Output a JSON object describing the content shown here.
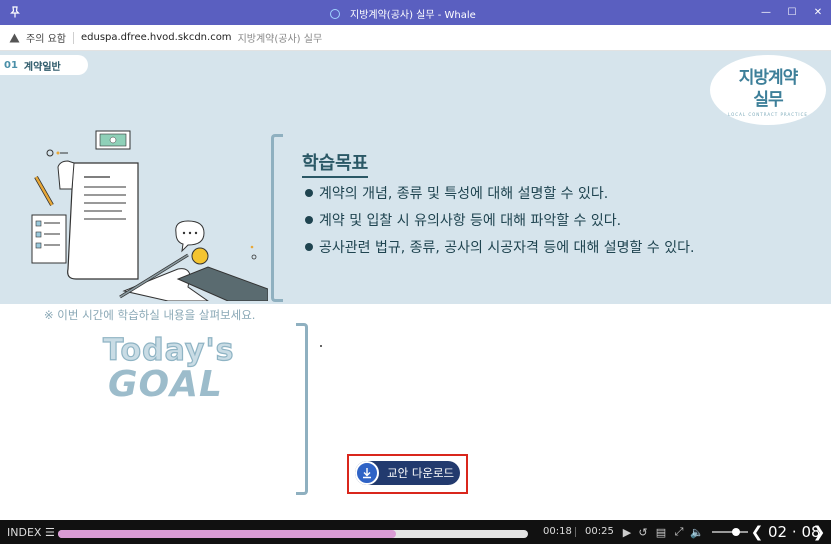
{
  "window": {
    "title": "지방계약(공사) 실무 - Whale"
  },
  "address": {
    "warning": "주의 요함",
    "url": "eduspa.dfree.hvod.skcdn.com",
    "page_title": "지방계약(공사) 실무"
  },
  "chapter": {
    "number": "01",
    "name": "계약일반"
  },
  "logo": {
    "line1": "지방계약",
    "line2": "실무",
    "tagline": "LOCAL CONTRACT PRACTICE"
  },
  "goals": {
    "title": "학습목표",
    "items": [
      "계약의 개념, 종류 및 특성에 대해 설명할 수 있다.",
      "계약 및 입찰 시 유의사항 등에 대해 파악할 수 있다.",
      "공사관련 법규, 종류, 공사의 시공자격 등에 대해 설명할 수 있다."
    ]
  },
  "hint": "※ 이번 시간에 학습하실 내용을 살펴보세요.",
  "today": {
    "line1": "Today's",
    "line2": "GOAL"
  },
  "download": {
    "label": "교안 다운로드"
  },
  "player": {
    "index_label": "INDEX",
    "current_time": "00:18",
    "total_time": "00:25",
    "progress": 0.72,
    "page": "02",
    "page_total": "08"
  }
}
